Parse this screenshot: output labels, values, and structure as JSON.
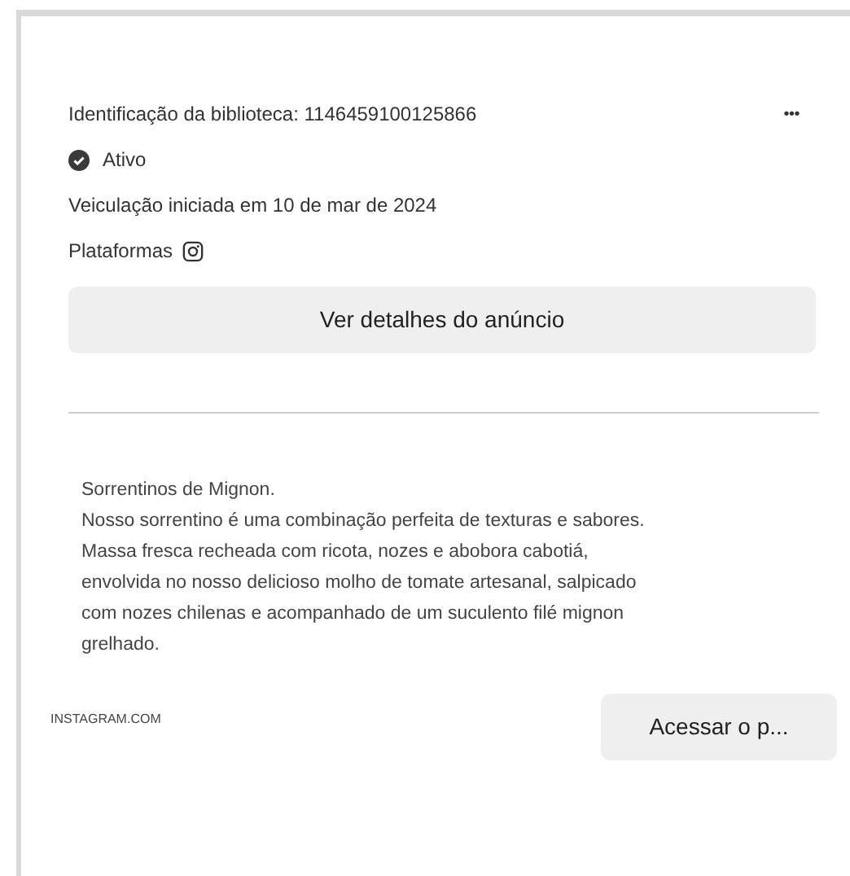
{
  "ad": {
    "library_id": "Identificação da biblioteca: 1146459100125866",
    "more_menu": "•••",
    "status": "Ativo",
    "started": "Veiculação iniciada em 10 de mar de 2024",
    "platforms_label": "Plataformas",
    "platforms": [
      {
        "kind": "instagram"
      }
    ],
    "details_button": "Ver detalhes do anúncio"
  },
  "creative": {
    "description": "Sorrentinos de Mignon.\nNosso sorrentino é uma combinação perfeita de texturas e sabores.\nMassa fresca recheada com ricota, nozes e abobora cabotiá,\nenvolvida no nosso delicioso molho de tomate artesanal, salpicado\ncom nozes chilenas e acompanhado de um suculento filé mignon\ngrelhado.",
    "domain": "INSTAGRAM.COM",
    "cta_button": "Acessar o p..."
  }
}
